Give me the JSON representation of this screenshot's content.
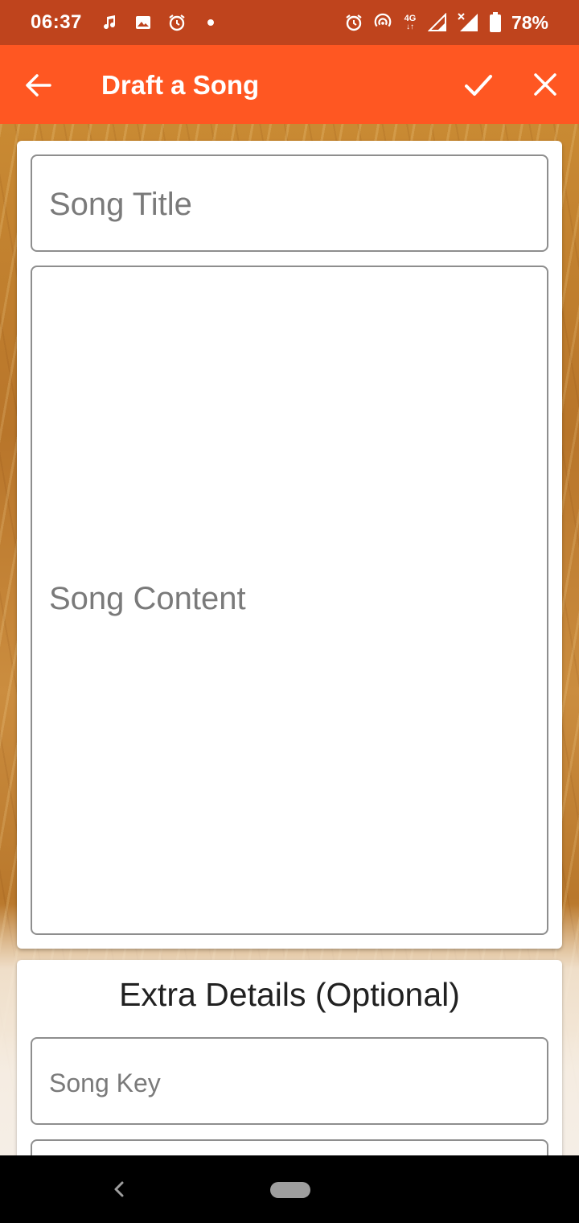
{
  "status_bar": {
    "time": "06:37",
    "battery": "78%",
    "network": "4G",
    "icons_left": [
      "music-note-icon",
      "image-icon",
      "alarm-icon",
      "dot-icon"
    ],
    "icons_right": [
      "alarm-icon",
      "hotspot-icon",
      "signal-icon",
      "signal-x-icon",
      "battery-icon"
    ]
  },
  "app_bar": {
    "title": "Draft a Song",
    "back_icon": "arrow-back-icon",
    "confirm_icon": "check-icon",
    "close_icon": "close-icon",
    "color": "#FF5722"
  },
  "form": {
    "title_placeholder": "Song Title",
    "content_placeholder": "Song Content"
  },
  "extra": {
    "heading": "Extra Details (Optional)",
    "key_placeholder": "Song Key"
  },
  "colors": {
    "status_bar": "#BF441D",
    "app_bar": "#FF5722",
    "field_border": "#8E8E8E",
    "placeholder": "#7A7A7A"
  }
}
